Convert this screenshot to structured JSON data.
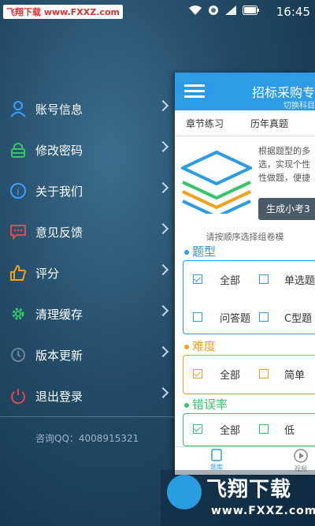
{
  "status_bar": {
    "watermark": "飞翔下载 www.FXXZ.com",
    "time": "16:45"
  },
  "menu": {
    "items": [
      {
        "label": "账号信息",
        "icon": "user-icon",
        "color": "#3aa0ff"
      },
      {
        "label": "修改密码",
        "icon": "lock-icon",
        "color": "#37c46a"
      },
      {
        "label": "关于我们",
        "icon": "info-icon",
        "color": "#3aa0ff"
      },
      {
        "label": "意见反馈",
        "icon": "chat-icon",
        "color": "#e24a4a"
      },
      {
        "label": "评分",
        "icon": "thumbs-up-icon",
        "color": "#f0a11e"
      },
      {
        "label": "清理缓存",
        "icon": "gear-icon",
        "color": "#37c46a"
      },
      {
        "label": "版本更新",
        "icon": "refresh-icon",
        "color": "#7a8a96"
      },
      {
        "label": "退出登录",
        "icon": "power-icon",
        "color": "#e24a4a"
      }
    ],
    "consult": "咨询QQ：4008915321"
  },
  "main": {
    "title": "招标采购专",
    "subtitle": "切换科目",
    "tabs": [
      "章节练习",
      "历年真题"
    ],
    "intro_lines": [
      "根据题型的多",
      "选，实现个性",
      "性做题，便捷"
    ],
    "generate_button": "生成小考3",
    "hint": "请按顺序选择组卷模",
    "sections": {
      "type": {
        "title": "题型",
        "color": "#2d9be6",
        "options": [
          "全部",
          "单选题",
          "问答题",
          "C型题"
        ]
      },
      "difficulty": {
        "title": "难度",
        "color": "#f0a11e",
        "options": [
          "全部",
          "简单"
        ]
      },
      "error_rate": {
        "title": "错误率",
        "color": "#37c46a",
        "options": [
          "全部",
          "低"
        ]
      }
    },
    "bottom_nav": [
      "题库",
      "视频"
    ]
  },
  "watermark_bottom": {
    "title": "飞翔下载",
    "url": "www.FXXZ.com"
  }
}
